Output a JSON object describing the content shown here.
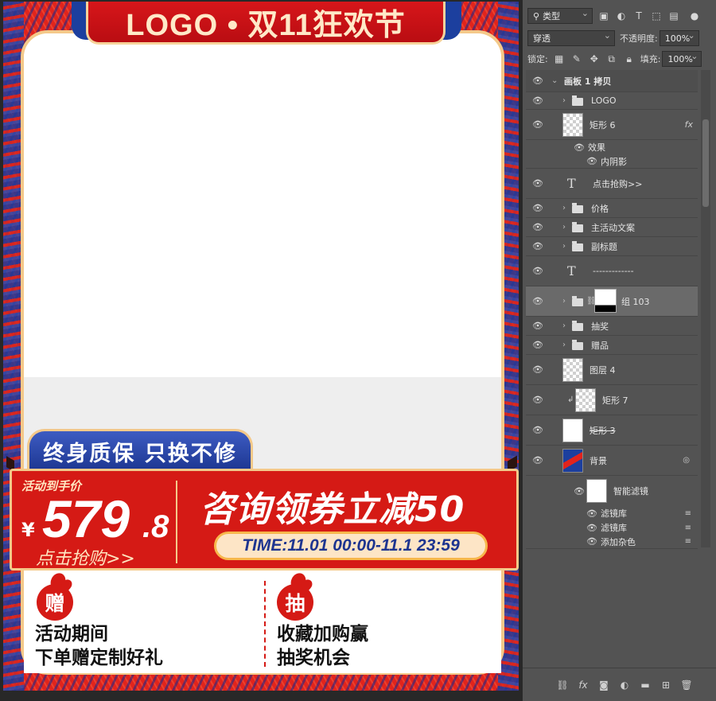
{
  "artboard": {
    "logo_text": "LOGO • 双11狂欢节",
    "guarantee_text": "终身质保 只换不修",
    "price_label": "活动到手价",
    "price_currency": "¥",
    "price_int": "579",
    "price_dec": ".8",
    "buy_now": "点击抢购>>",
    "coupon_headline": "咨询领券立减50",
    "time_text": "TIME:11.01 00:00-11.1 23:59",
    "gift_left": {
      "badge": "赠",
      "line1": "活动期间",
      "line2": "下单赠定制好礼"
    },
    "gift_right": {
      "badge": "抽",
      "line1": "收藏加购赢",
      "line2": "抽奖机会"
    }
  },
  "panel": {
    "filter_type": "类型",
    "blend_mode": "穿透",
    "opacity_label": "不透明度:",
    "opacity_value": "100%",
    "lock_label": "锁定:",
    "fill_label": "填充:",
    "fill_value": "100%",
    "layers": [
      {
        "name": "画板 1 拷贝",
        "kind": "artboard"
      },
      {
        "name": "LOGO",
        "kind": "folder"
      },
      {
        "name": "矩形 6",
        "kind": "shape",
        "fx": "fx"
      },
      {
        "name": "效果",
        "kind": "effect"
      },
      {
        "name": "内阴影",
        "kind": "effect-item"
      },
      {
        "name": "点击抢购>>",
        "kind": "text"
      },
      {
        "name": "价格",
        "kind": "folder"
      },
      {
        "name": "主活动文案",
        "kind": "folder"
      },
      {
        "name": "副标题",
        "kind": "folder"
      },
      {
        "name": "-------------",
        "kind": "text"
      },
      {
        "name": "组 103",
        "kind": "masked-folder"
      },
      {
        "name": "抽奖",
        "kind": "folder"
      },
      {
        "name": "赠品",
        "kind": "folder"
      },
      {
        "name": "图层 4",
        "kind": "pixel"
      },
      {
        "name": "矩形 7",
        "kind": "clipped-shape"
      },
      {
        "name": "矩形 3",
        "kind": "white-shape"
      },
      {
        "name": "背景",
        "kind": "smart"
      },
      {
        "name": "智能滤镜",
        "kind": "smart-filter"
      },
      {
        "name": "滤镜库",
        "kind": "filter"
      },
      {
        "name": "滤镜库",
        "kind": "filter"
      },
      {
        "name": "添加杂色",
        "kind": "filter"
      }
    ]
  },
  "colors": {
    "accent_red": "#d51a15",
    "accent_blue": "#1c3f9e",
    "gold": "#f4c98a",
    "panel_bg": "#535353"
  }
}
